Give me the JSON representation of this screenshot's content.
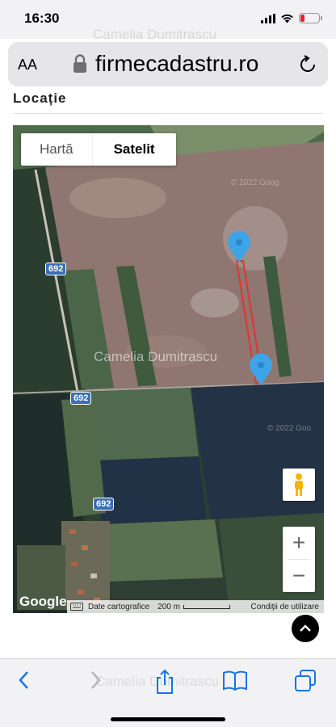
{
  "status_bar": {
    "time": "16:30",
    "watermark": "Camelia Dumitrascu",
    "icons": [
      "cellular-signal-icon",
      "wifi-icon",
      "battery-low-icon"
    ],
    "battery_color": "#e0262b"
  },
  "browser": {
    "text_size_label": "AA",
    "url": "firmecadastru.ro",
    "icons": [
      "lock-icon",
      "reload-icon"
    ]
  },
  "page": {
    "section_title": "Locație"
  },
  "map": {
    "map_type_options": [
      "Hartă",
      "Satelit"
    ],
    "selected_map_type": "Satelit",
    "road_labels": [
      "692",
      "692",
      "692"
    ],
    "watermark": "Camelia Dumitrascu",
    "imagery_watermarks": [
      "© 2022 Goog",
      "© 2022 Goo"
    ],
    "google_logo": "Google",
    "attribution": {
      "map_data": "Date cartografice",
      "scale": "200 m",
      "terms": "Condiții de utilizare"
    },
    "zoom_in_label": "+",
    "zoom_out_label": "−",
    "markers": 2,
    "route_color": "#e8322f",
    "marker_color": "#3da4e8"
  },
  "toolbar": {
    "watermark": "Camelia Dumitrascu",
    "icons": [
      "back-icon",
      "forward-icon",
      "share-icon",
      "bookmarks-icon",
      "tabs-icon"
    ]
  }
}
